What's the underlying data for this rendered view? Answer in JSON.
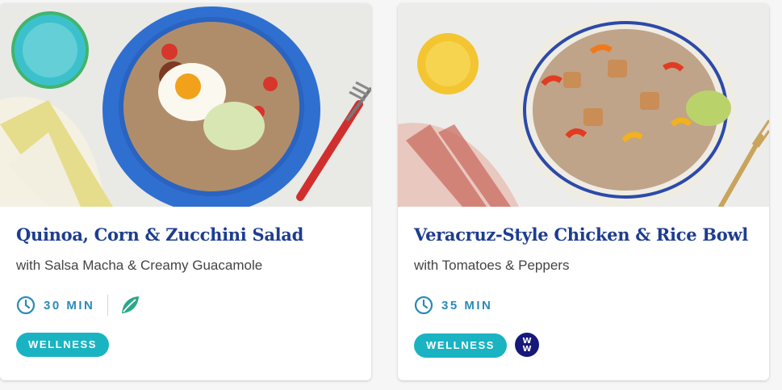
{
  "cards": [
    {
      "title": "Quinoa, Corn & Zucchini Salad",
      "subtitle": "with Salsa Macha & Creamy Guacamole",
      "time": "30 MIN",
      "badge": "WELLNESS",
      "icons": [
        "clock-icon",
        "leaf-icon"
      ],
      "image": "quinoa-corn-zucchini-salad-photo"
    },
    {
      "title": "Veracruz-Style Chicken & Rice Bowl",
      "subtitle": "with Tomatoes & Peppers",
      "time": "35 MIN",
      "badge": "WELLNESS",
      "icons": [
        "clock-icon",
        "ww-logo-icon"
      ],
      "ww_logo_text": "WW",
      "image": "veracruz-chicken-rice-bowl-photo"
    }
  ],
  "colors": {
    "title": "#1d3d8f",
    "time": "#2a8ab8",
    "badge": "#1ab3c2",
    "leaf": "#2aa889",
    "ww": "#16197a"
  }
}
